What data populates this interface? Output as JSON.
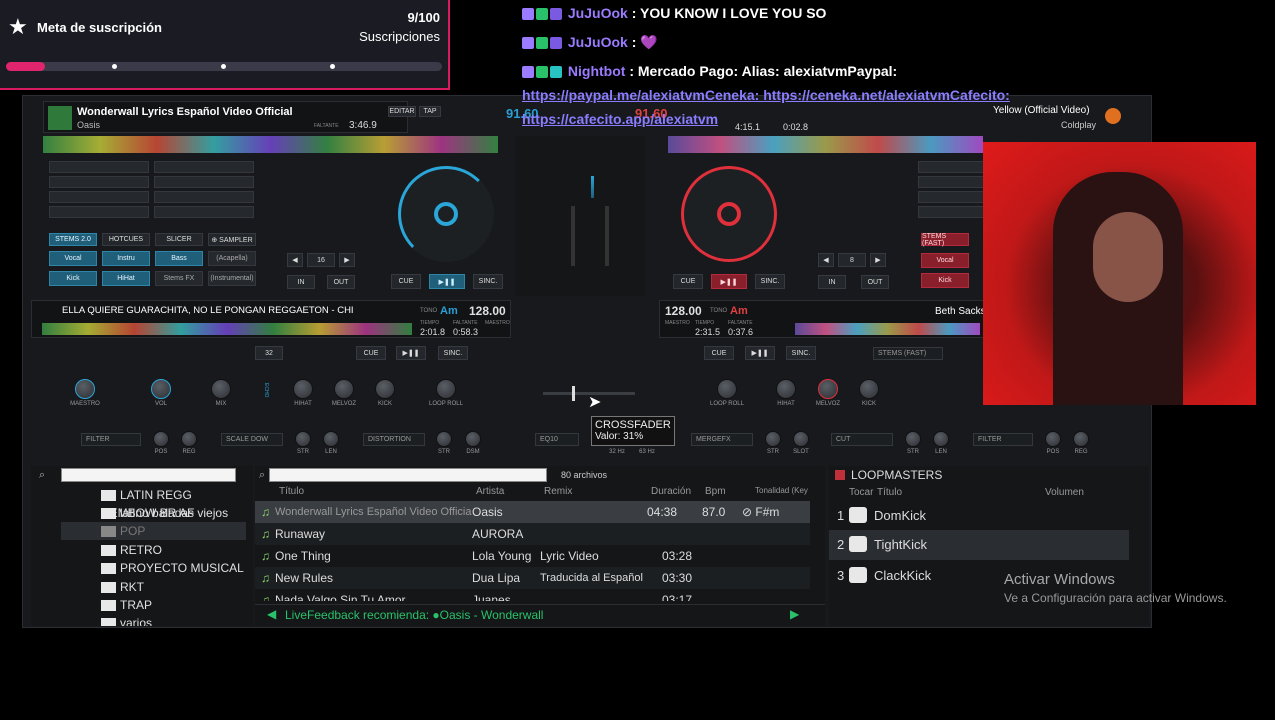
{
  "sub_goal": {
    "title": "Meta de suscripción",
    "count": "9/100",
    "label": "Suscripciones",
    "progress": 0.09
  },
  "chat": [
    {
      "user": "JuJuOok",
      "text": ": YOU KNOW I LOVE YOU SO"
    },
    {
      "user": "JuJuOok",
      "text": ":",
      "emote": "💜"
    },
    {
      "user": "Nightbot",
      "text": ": Mercado Pago: Alias: alexiatvmPaypal:",
      "link1": "https://paypal.me/alexiatvmCeneka: https://ceneka.net/alexiatvmCafecito:",
      "link2": "https://cafecito.app/alexiatvm"
    }
  ],
  "deck_a": {
    "title": "Wonderwall  Lyrics  Español  Video Official",
    "artist": "Oasis",
    "faltante_label": "FALTANTE",
    "time": "3:46.9",
    "bpm": "91.60",
    "edit": "EDITAR",
    "tap": "TAP"
  },
  "deck_b": {
    "title": "Yellow (Official Video)",
    "artist": "Coldplay",
    "bpm": "91.60",
    "time1": "4:15.1",
    "time2": "0:02.8"
  },
  "deck_c": {
    "title": "ELLA QUIERE GUARACHITA, NO LE PONGAN REGGAETON - CHI",
    "tono_label": "TONO",
    "key": "Am",
    "bpm": "128.00",
    "tiempo_label": "TIEMPO",
    "faltante_label": "FALTANTE",
    "tiempo": "2:01.8",
    "faltante": "0:58.3",
    "maestro": "MAESTRO",
    "loop": "32"
  },
  "deck_d": {
    "title": "Beth Sacks",
    "bpm": "128.00",
    "tono_label": "TONO",
    "key": "Am",
    "tiempo_label": "TIEMPO",
    "faltante_label": "FALTANTE",
    "tiempo": "2:31.5",
    "faltante": "0:37.6",
    "maestro": "MAESTRO",
    "stems": "STEMS (FAST)"
  },
  "pads_left": {
    "tabs": [
      "STEMS 2.0",
      "HOTCUES",
      "SLICER",
      "⊕ SAMPLER"
    ],
    "row1": [
      "Vocal",
      "Instru",
      "Bass",
      "(Acapella)"
    ],
    "row2": [
      "Kick",
      "HiHat",
      "Stems FX",
      "(Instrumental)"
    ],
    "loop": "16",
    "in": "IN",
    "out": "OUT"
  },
  "pads_right": {
    "tab": "STEMS (FAST)",
    "row1": [
      "Vocal"
    ],
    "row2": [
      "Kick"
    ],
    "loop": "8",
    "in": "IN",
    "out": "OUT"
  },
  "transport": {
    "cue": "CUE",
    "play": "▶❚❚",
    "sync": "SINC."
  },
  "fx_left": {
    "labels": [
      "MAESTRO",
      "VOL",
      "MIX",
      "HIHAT",
      "MELVOZ",
      "KICK",
      "LOOP ROLL"
    ],
    "filter": "FILTER",
    "scale": "SCALE DOW",
    "distortion": "DISTORTION",
    "k1": "POS",
    "k2": "REG",
    "k3": "STR",
    "k4": "LEN",
    "k5": "STR",
    "k6": "DSM",
    "echo": "ECHO"
  },
  "fx_right": {
    "labels": [
      "LOOP ROLL",
      "HIHAT",
      "MELVOZ",
      "KICK"
    ],
    "merge": "MERGEFX",
    "cut": "CUT",
    "filter": "FILTER",
    "k1": "STR",
    "k2": "SLOT",
    "k3": "STR",
    "k4": "LEN",
    "k5": "POS",
    "k6": "REG"
  },
  "crossfader": {
    "tooltip_title": "CROSSFADER",
    "tooltip_value": "Valor: 31%",
    "hz1": "32 Hz",
    "hz2": "63 Hz",
    "eq": "EQ10",
    "fraction": 0.31
  },
  "browser": {
    "archivos": "80 archivos",
    "folders": [
      "LATIN REGG DEMBOW BR AF",
      "latino baladas viejos etc",
      "POP",
      "RETRO",
      "PROYECTO MUSICAL",
      "RKT",
      "TRAP",
      "varios"
    ],
    "columns": [
      "Título",
      "Artista",
      "Remix",
      "Duración",
      "Bpm",
      "Tonalidad (Key"
    ],
    "rows": [
      {
        "title": "Wonderwall  Lyrics  Español  Video Official",
        "artist": "Oasis",
        "remix": "",
        "dur": "04:38",
        "bpm": "87.0",
        "key": "⊘ F#m"
      },
      {
        "title": "Runaway",
        "artist": "AURORA",
        "remix": "",
        "dur": "",
        "bpm": "",
        "key": ""
      },
      {
        "title": "One Thing",
        "artist": "Lola Young",
        "remix": "Lyric Video",
        "dur": "03:28",
        "bpm": "",
        "key": ""
      },
      {
        "title": "New Rules",
        "artist": "Dua Lipa",
        "remix": "Traducida al Español",
        "dur": "03:30",
        "bpm": "",
        "key": ""
      },
      {
        "title": "Nada Valgo Sin Tu Amor",
        "artist": "Juanes",
        "remix": "",
        "dur": "03:17",
        "bpm": "",
        "key": ""
      }
    ],
    "feedback": "LiveFeedback recomienda: ●Oasis - Wonderwall"
  },
  "sampler": {
    "title": "LOOPMASTERS",
    "columns": [
      "Tocar",
      "Título",
      "Volumen"
    ],
    "items": [
      {
        "n": "1",
        "name": "DomKick"
      },
      {
        "n": "2",
        "name": "TightKick"
      },
      {
        "n": "3",
        "name": "ClackKick"
      }
    ]
  },
  "windows": {
    "line1": "Activar Windows",
    "line2": "Ve a Configuración para activar Windows."
  },
  "colors": {
    "accent_a": "#2aa6d8",
    "accent_b": "#e0303c",
    "bpm_a": "#2a9fd6",
    "bpm_b": "#e04040"
  }
}
